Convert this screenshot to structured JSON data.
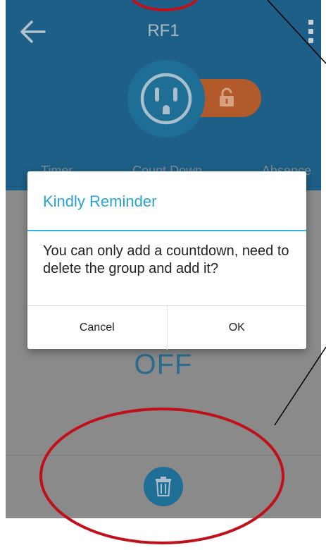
{
  "header": {
    "title": "RF1",
    "back_icon": "arrow-left-icon",
    "menu_icon": "more-vert-icon"
  },
  "device": {
    "outlet_icon": "power-outlet-icon",
    "lock_icon": "unlock-icon",
    "lock_color": "#b35a2b"
  },
  "mode_tabs": [
    "Timer",
    "Count Down",
    "Absence"
  ],
  "status": {
    "state": "OFF"
  },
  "dialog": {
    "title": "Kindly Reminder",
    "message": "You can only add a countdown, need to delete the group and add it?",
    "cancel_label": "Cancel",
    "ok_label": "OK"
  },
  "bottom": {
    "delete_icon": "trash-icon"
  },
  "colors": {
    "header_bg": "#1d5f86",
    "accent": "#33b5e5",
    "annotation_red": "#c0101a"
  }
}
